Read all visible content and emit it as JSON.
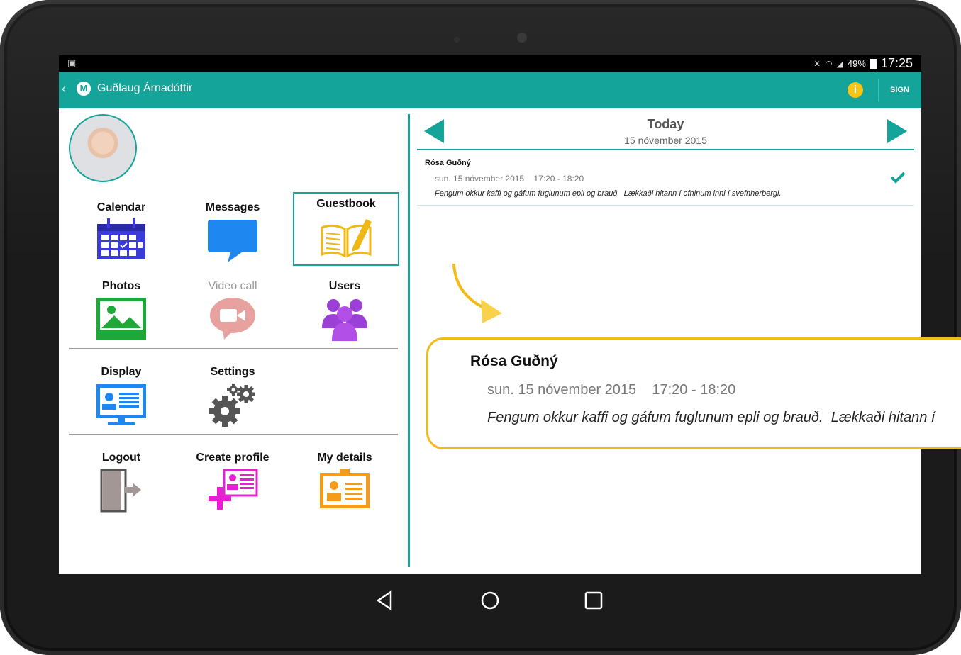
{
  "statusbar": {
    "battery": "49%",
    "time": "17:25"
  },
  "appbar": {
    "back": "‹",
    "logo_letter": "M",
    "title": "Guðlaug Árnadóttir",
    "info": "i",
    "sign": "SIGN"
  },
  "menu": {
    "calendar": "Calendar",
    "messages": "Messages",
    "guestbook": "Guestbook",
    "photos": "Photos",
    "video_call": "Video call",
    "users": "Users",
    "display": "Display",
    "settings": "Settings",
    "logout": "Logout",
    "create_profile": "Create profile",
    "my_details": "My details"
  },
  "guestbook": {
    "heading": "Today",
    "date": "15 nóvember 2015",
    "entry": {
      "name": "Rósa Guðný",
      "time": "sun. 15 nóvember 2015    17:20 - 18:20",
      "text": "Fengum okkur kaffi og gáfum fuglunum epli og brauð.  Lækkaði hitann í ofninum inni í svefnherbergi."
    }
  },
  "callout": {
    "name": "Rósa Guðný",
    "time": "sun. 15 nóvember 2015    17:20 - 18:20",
    "text": "Fengum okkur kaffi og gáfum fuglunum epli og brauð.  Lækkaði hitann í"
  },
  "colors": {
    "accent": "#14a49a",
    "highlight": "#f3bb16"
  }
}
